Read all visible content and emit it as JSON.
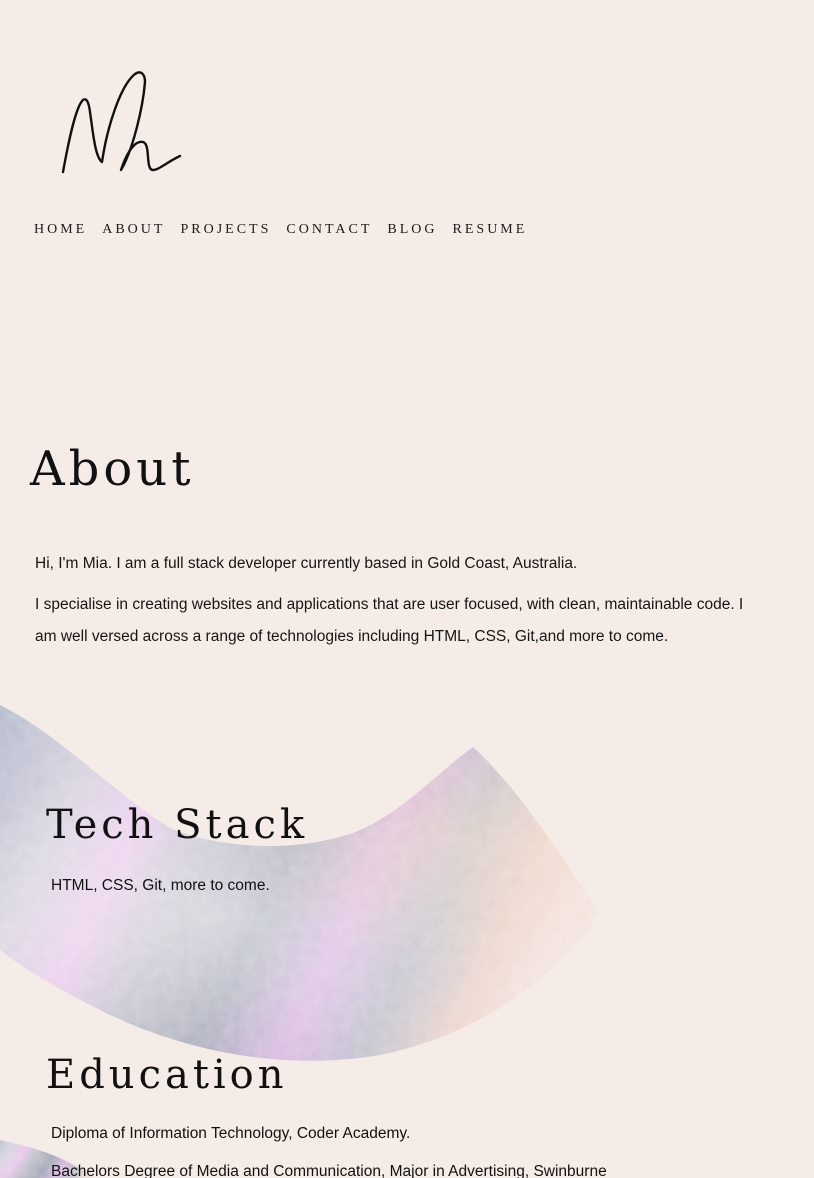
{
  "brand": {
    "logo_text": "Mh"
  },
  "nav": {
    "items": [
      {
        "label": "HOME"
      },
      {
        "label": "ABOUT"
      },
      {
        "label": "PROJECTS"
      },
      {
        "label": "CONTACT"
      },
      {
        "label": "BLOG"
      },
      {
        "label": "RESUME"
      }
    ]
  },
  "about": {
    "heading": "About",
    "intro": "Hi, I'm Mia. I am a full stack developer currently based in Gold Coast, Australia.",
    "body": "I specialise in creating websites and applications that are user focused, with clean, maintainable code. I am well versed across a range of technologies including HTML, CSS, Git,and more to come."
  },
  "tech_stack": {
    "heading": "Tech Stack",
    "text": "HTML, CSS, Git, more to come."
  },
  "education": {
    "heading": "Education",
    "items": [
      "Diploma of Information Technology, Coder Academy.",
      "Bachelors Degree of Media and Communication, Major in Advertising, Swinburne"
    ]
  },
  "colors": {
    "background": "#f6ece7",
    "text": "#111111",
    "swoosh_silver": "#b8bcc8",
    "swoosh_lilac": "#d9b6e3",
    "swoosh_pink": "#f2d3e8"
  }
}
